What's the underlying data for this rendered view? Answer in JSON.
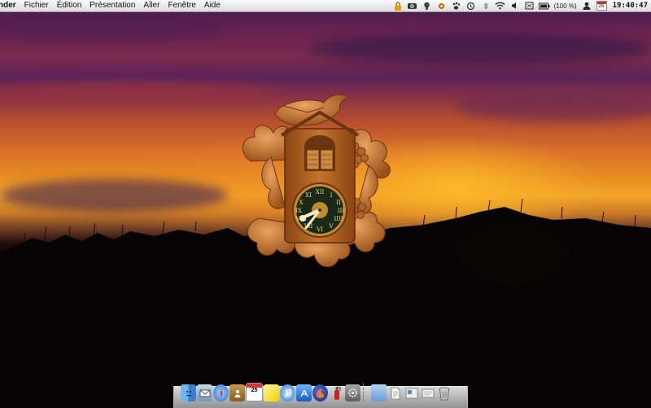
{
  "menubar": {
    "app_name": "nder",
    "items": [
      "Fichier",
      "Édition",
      "Présentation",
      "Aller",
      "Fenêtre",
      "Aide"
    ],
    "status_icons": [
      "lock-icon",
      "camera-icon",
      "lightbulb-icon",
      "settings-icon",
      "paw-icon",
      "time-machine-icon",
      "bluetooth-icon",
      "wifi-icon",
      "volume-icon",
      "screen-icon",
      "battery-icon",
      "user-icon",
      "calendar-icon"
    ],
    "battery_text": "(100 %)",
    "calendar_day": "25",
    "clock": "19:40:47"
  },
  "widget": {
    "name": "cuckoo-clock",
    "colors": {
      "wood": "#a85a20",
      "wood_light": "#d48840",
      "dial": "#1b2a16",
      "hands": "#f4ecc8"
    }
  },
  "dock": {
    "calendar_day": "25",
    "icons": [
      "finder-icon",
      "mail-icon",
      "safari-icon",
      "address-book-icon",
      "ical-icon",
      "stickies-icon",
      "itunes-icon",
      "appstore-icon",
      "firefox-icon",
      "fire-extinguisher-icon",
      "system-preferences-icon",
      "folder-icon",
      "document-icon",
      "preview-icon",
      "text-icon",
      "trash-icon"
    ]
  },
  "wallpaper": {
    "colors": {
      "sky_top": "#3f1a4a",
      "sunset": "#f2a428",
      "ground": "#000000"
    }
  }
}
